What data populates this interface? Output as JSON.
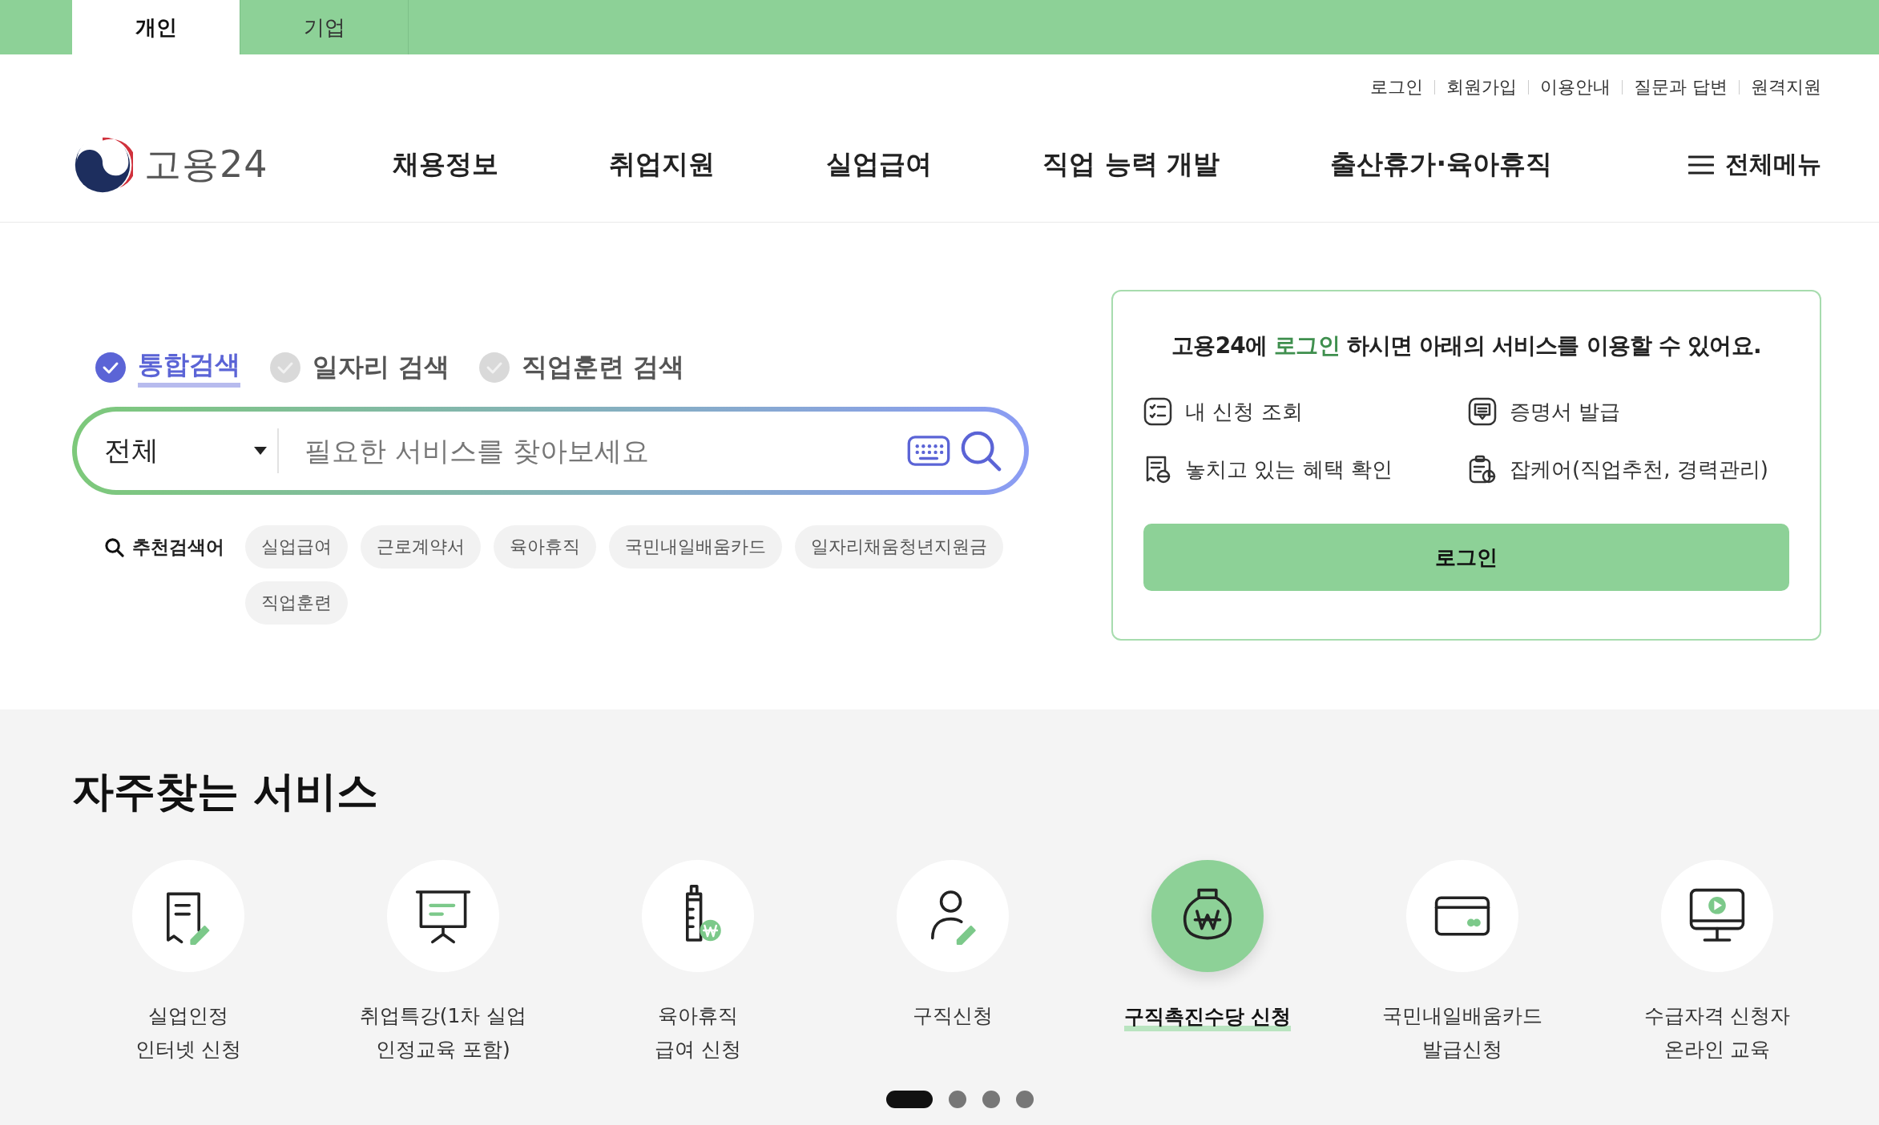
{
  "account_tabs": [
    {
      "label": "개인",
      "selected": true
    },
    {
      "label": "기업",
      "selected": false
    }
  ],
  "utility_links": [
    "로그인",
    "회원가입",
    "이용안내",
    "질문과 답변",
    "원격지원"
  ],
  "logo": {
    "text": "고용24"
  },
  "nav": [
    "채용정보",
    "취업지원",
    "실업급여",
    "직업 능력 개발",
    "출산휴가·육아휴직"
  ],
  "all_menu": {
    "label": "전체메뉴"
  },
  "search_types": [
    {
      "label": "통합검색",
      "selected": true
    },
    {
      "label": "일자리 검색",
      "selected": false
    },
    {
      "label": "직업훈련 검색",
      "selected": false
    }
  ],
  "search": {
    "category": "전체",
    "placeholder": "필요한 서비스를 찾아보세요"
  },
  "recommended": {
    "label": "추천검색어",
    "tags": [
      "실업급여",
      "근로계약서",
      "육아휴직",
      "국민내일배움카드",
      "일자리채움청년지원금",
      "직업훈련"
    ]
  },
  "login_card": {
    "headline": [
      {
        "text": "고용24에 ",
        "highlight": false
      },
      {
        "text": "로그인",
        "highlight": true
      },
      {
        "text": " 하시면 아래의 서비스를 이용할 수 있어요.",
        "highlight": false
      }
    ],
    "services": [
      {
        "label": "내 신청 조회",
        "kind": "checklist"
      },
      {
        "label": "증명서 발급",
        "kind": "certificate"
      },
      {
        "label": "놓치고 있는 혜택 확인",
        "kind": "receipt"
      },
      {
        "label": "잡케어(직업추천, 경력관리)",
        "kind": "clipboard"
      }
    ],
    "button": "로그인"
  },
  "frequent": {
    "title": "자주찾는 서비스",
    "items": [
      {
        "lines": [
          "실업인정",
          "인터넷 신청"
        ],
        "kind": "document",
        "selected": false
      },
      {
        "lines": [
          "취업특강(1차 실업",
          "인정교육 포함)"
        ],
        "kind": "board",
        "selected": false
      },
      {
        "lines": [
          "육아휴직",
          "급여 신청"
        ],
        "kind": "bottle",
        "selected": false
      },
      {
        "lines": [
          "구직신청"
        ],
        "kind": "person",
        "selected": false
      },
      {
        "lines": [
          "구직촉진수당 신청"
        ],
        "kind": "moneybag",
        "selected": true
      },
      {
        "lines": [
          "국민내일배움카드",
          "발급신청"
        ],
        "kind": "card",
        "selected": false
      },
      {
        "lines": [
          "수급자격 신청자",
          "온라인 교육"
        ],
        "kind": "monitor",
        "selected": false
      }
    ],
    "pager": [
      {
        "selected": true
      },
      {
        "selected": false
      },
      {
        "selected": false
      },
      {
        "selected": false
      }
    ]
  }
}
